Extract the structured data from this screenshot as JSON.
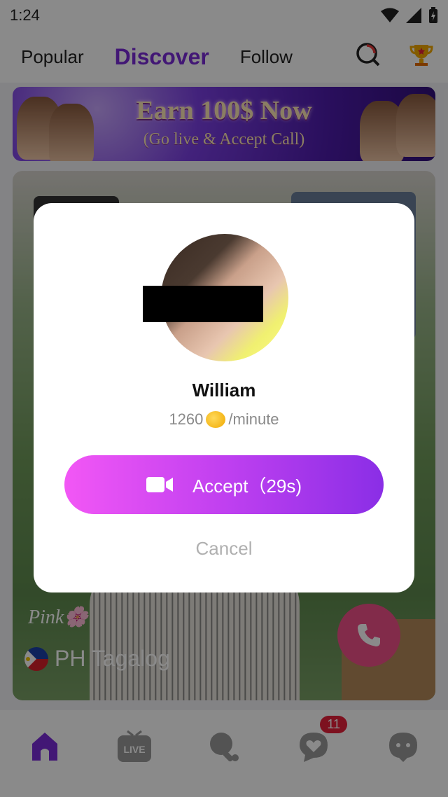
{
  "status_bar": {
    "time": "1:24"
  },
  "top_nav": {
    "tabs": [
      {
        "label": "Popular",
        "active": false
      },
      {
        "label": "Discover",
        "active": true
      },
      {
        "label": "Follow",
        "active": false
      }
    ]
  },
  "banner": {
    "title": "Earn 100$ Now",
    "subtitle": "(Go live & Accept Call)"
  },
  "card": {
    "nickname": "Pink🌸",
    "region": "PH Tagalog"
  },
  "bottom_nav": {
    "items": [
      {
        "icon": "home-icon",
        "active": true
      },
      {
        "icon": "live-icon"
      },
      {
        "icon": "ping-pong-icon"
      },
      {
        "icon": "heart-chat-icon",
        "badge": "11"
      },
      {
        "icon": "chat-bubble-icon"
      }
    ],
    "messages_badge": "11",
    "live_label": "LIVE"
  },
  "dialog": {
    "name": "William",
    "price_amount": "1260",
    "price_unit": "/minute",
    "accept_label": "Accept（29s)",
    "cancel_label": "Cancel"
  },
  "colors": {
    "accent": "#7a2bd8",
    "accept_gradient_start": "#f257f5",
    "accept_gradient_end": "#8a2ee6",
    "call_button": "#f0508a",
    "badge": "#e8203a"
  }
}
